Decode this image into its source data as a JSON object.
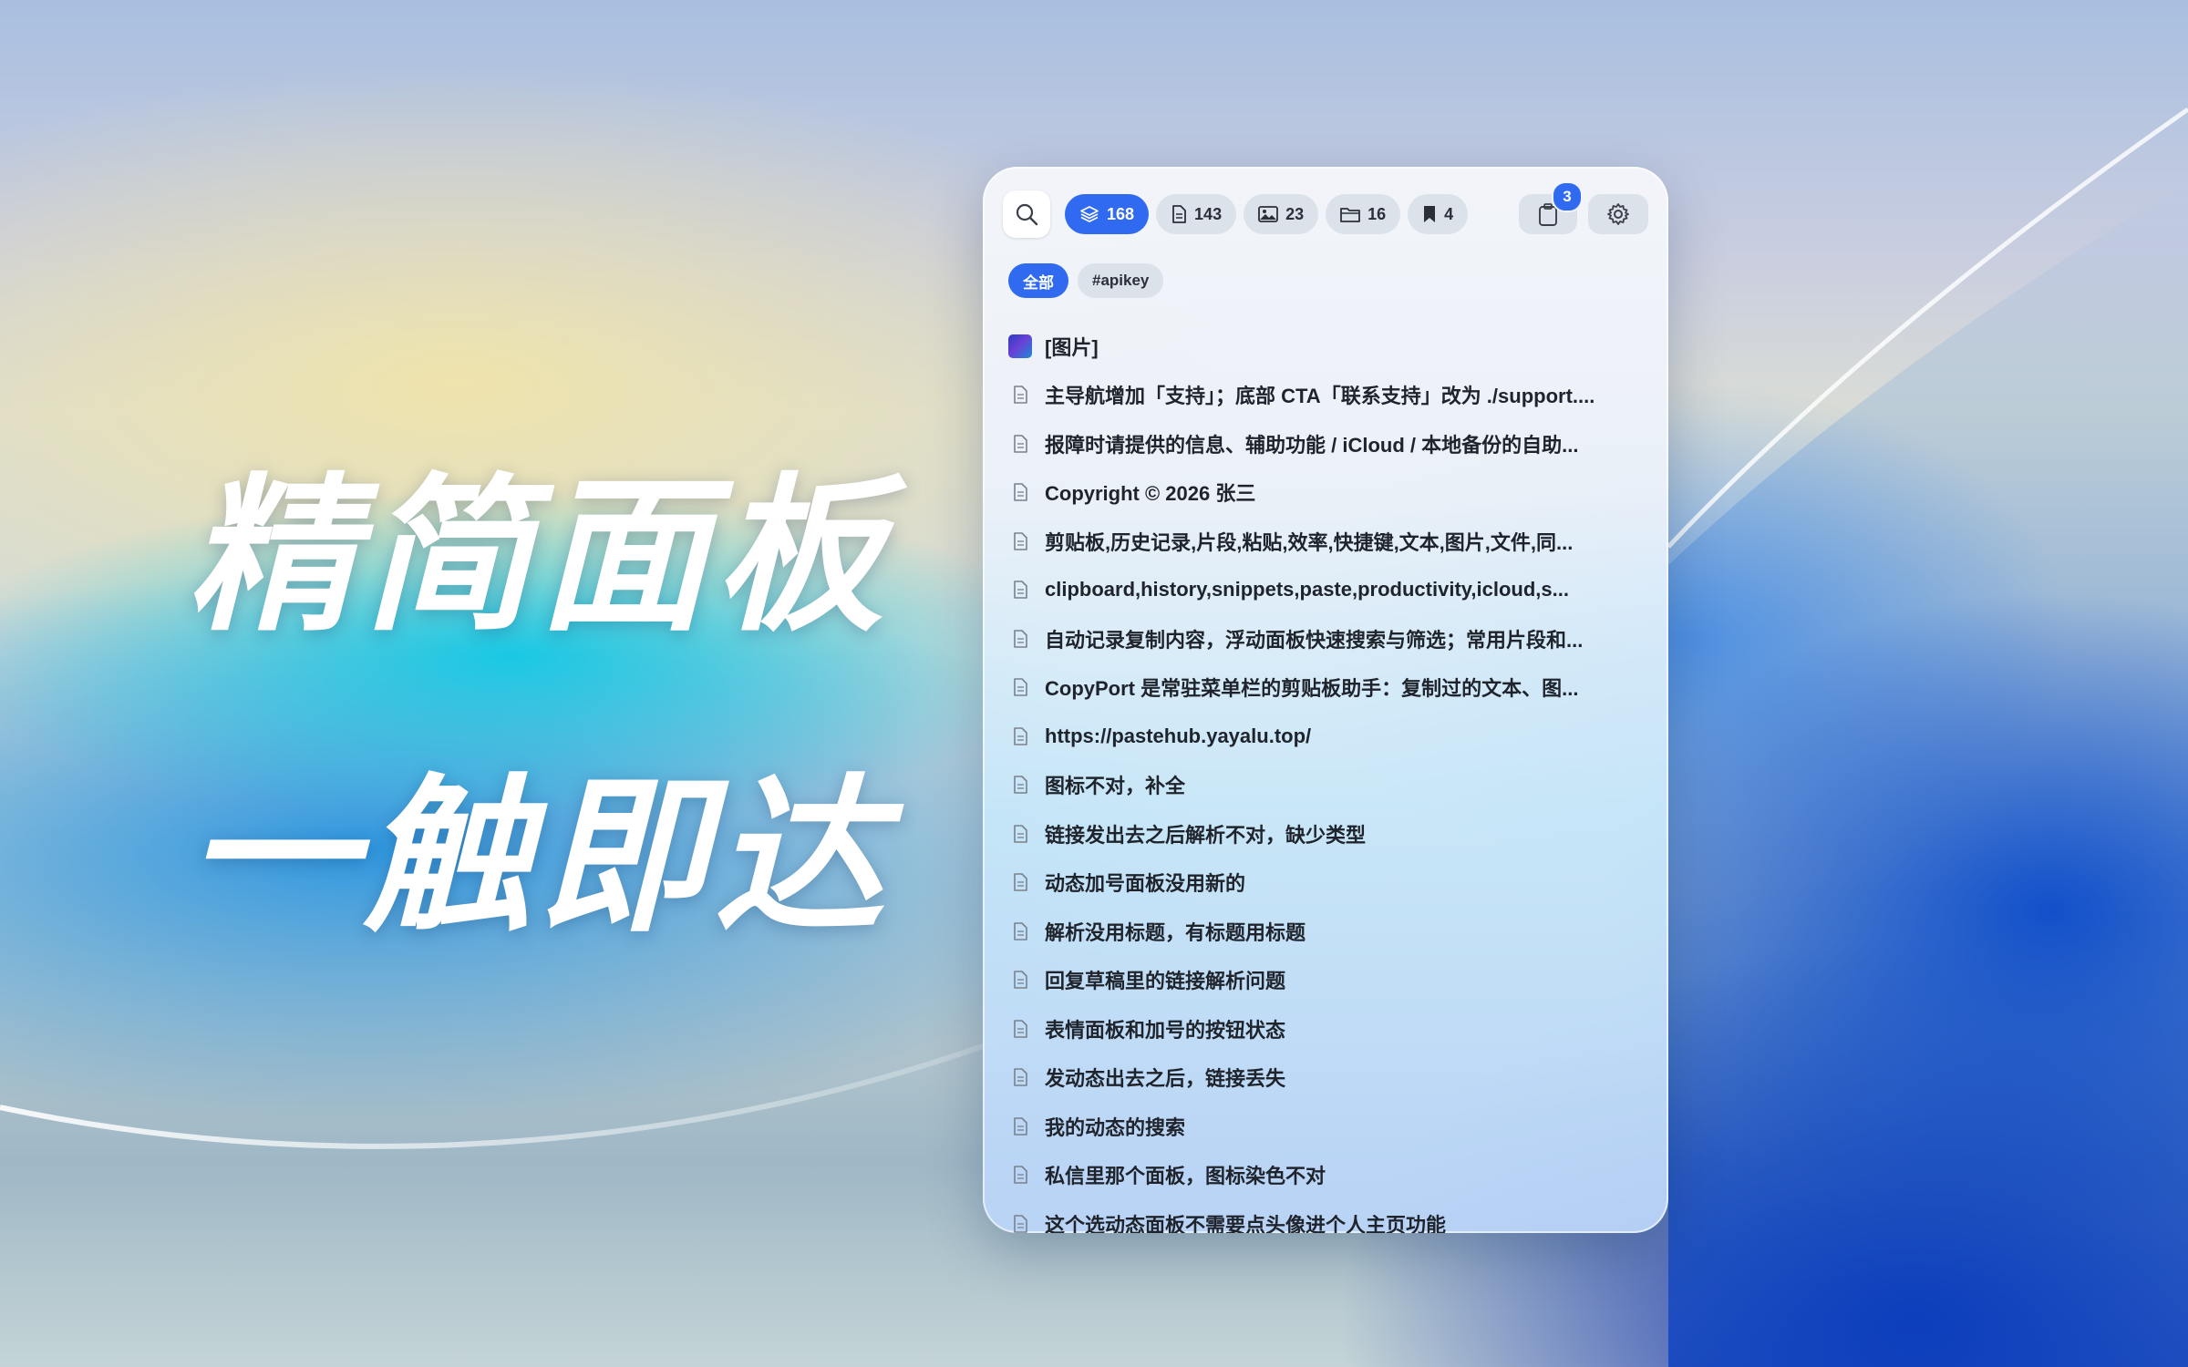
{
  "hero": {
    "line1": "精简面板",
    "line2": "一触即达"
  },
  "toolbar": {
    "search_icon": "search-icon",
    "filters": [
      {
        "icon": "stack-icon",
        "count": "168",
        "active": true
      },
      {
        "icon": "document-icon",
        "count": "143",
        "active": false
      },
      {
        "icon": "image-icon",
        "count": "23",
        "active": false
      },
      {
        "icon": "folder-icon",
        "count": "16",
        "active": false
      },
      {
        "icon": "bookmark-icon",
        "count": "4",
        "active": false
      }
    ],
    "clipboard_badge": "3",
    "settings_icon": "gear-icon"
  },
  "tags": [
    {
      "label": "全部",
      "active": true
    },
    {
      "label": "#apikey",
      "active": false
    }
  ],
  "items": [
    {
      "type": "image",
      "text": "[图片]"
    },
    {
      "type": "text",
      "text": "主导航增加「支持」；底部 CTA「联系支持」改为 ./support...."
    },
    {
      "type": "text",
      "text": "报障时请提供的信息、辅助功能 / iCloud / 本地备份的自助..."
    },
    {
      "type": "text",
      "text": "Copyright © 2026 张三"
    },
    {
      "type": "text",
      "text": "剪贴板,历史记录,片段,粘贴,效率,快捷键,文本,图片,文件,同..."
    },
    {
      "type": "text",
      "text": "clipboard,history,snippets,paste,productivity,icloud,s..."
    },
    {
      "type": "text",
      "text": "自动记录复制内容，浮动面板快速搜索与筛选；常用片段和..."
    },
    {
      "type": "text",
      "text": "CopyPort 是常驻菜单栏的剪贴板助手：复制过的文本、图..."
    },
    {
      "type": "text",
      "text": "https://pastehub.yayalu.top/"
    },
    {
      "type": "text",
      "text": "图标不对，补全"
    },
    {
      "type": "text",
      "text": "链接发出去之后解析不对，缺少类型"
    },
    {
      "type": "text",
      "text": "动态加号面板没用新的"
    },
    {
      "type": "text",
      "text": "解析没用标题，有标题用标题"
    },
    {
      "type": "text",
      "text": "回复草稿里的链接解析问题"
    },
    {
      "type": "text",
      "text": "表情面板和加号的按钮状态"
    },
    {
      "type": "text",
      "text": "发动态出去之后，链接丢失"
    },
    {
      "type": "text",
      "text": "我的动态的搜索"
    },
    {
      "type": "text",
      "text": "私信里那个面板，图标染色不对"
    },
    {
      "type": "text",
      "text": "这个选动态面板不需要点头像进个人主页功能"
    }
  ],
  "colors": {
    "accent": "#2f6af0",
    "pill_bg": "#d7dee8",
    "text": "#1f242c"
  }
}
